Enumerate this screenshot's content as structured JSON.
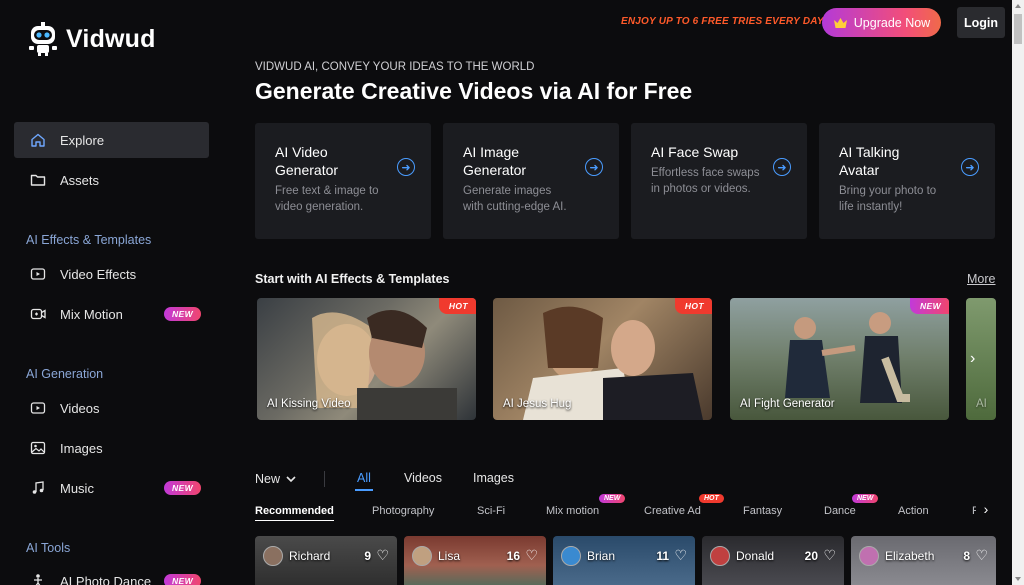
{
  "brand": {
    "name": "Vidwud"
  },
  "sidebar": {
    "top_items": [
      {
        "label": "Explore",
        "icon": "home-icon",
        "active": true
      },
      {
        "label": "Assets",
        "icon": "folder-icon"
      }
    ],
    "sections": [
      {
        "title": "AI Effects & Templates",
        "items": [
          {
            "label": "Video Effects",
            "icon": "video-effects-icon"
          },
          {
            "label": "Mix Motion",
            "icon": "mix-motion-icon",
            "badge": "NEW"
          }
        ]
      },
      {
        "title": "AI Generation",
        "items": [
          {
            "label": "Videos",
            "icon": "video-icon"
          },
          {
            "label": "Images",
            "icon": "image-icon"
          },
          {
            "label": "Music",
            "icon": "music-icon",
            "badge": "NEW"
          }
        ]
      },
      {
        "title": "AI Tools",
        "items": [
          {
            "label": "AI Photo Dance",
            "icon": "dance-icon",
            "badge": "NEW"
          }
        ]
      }
    ]
  },
  "topbar": {
    "promo": "ENJOY UP TO 6 FREE TRIES EVERY DAY!",
    "upgrade_label": "Upgrade Now",
    "login_label": "Login"
  },
  "hero": {
    "tagline": "VIDWUD AI, CONVEY YOUR IDEAS TO THE WORLD",
    "headline": "Generate Creative Videos via AI for Free"
  },
  "tools": [
    {
      "title": "AI Video Generator",
      "desc": "Free text & image to video generation."
    },
    {
      "title": "AI Image Generator",
      "desc": "Generate images with cutting-edge AI."
    },
    {
      "title": "AI Face Swap",
      "desc": "Effortless face swaps in photos or videos."
    },
    {
      "title": "AI Talking Avatar",
      "desc": "Bring your photo to life instantly!"
    }
  ],
  "templates_section": {
    "title": "Start with AI Effects & Templates",
    "more_label": "More",
    "items": [
      {
        "label": "AI Kissing Video",
        "badge": "HOT"
      },
      {
        "label": "AI Jesus Hug",
        "badge": "HOT"
      },
      {
        "label": "AI Fight Generator",
        "badge": "NEW"
      },
      {
        "label": "AI"
      }
    ]
  },
  "filters": {
    "sort_label": "New",
    "type_tabs": [
      "All",
      "Videos",
      "Images"
    ],
    "active_type": "All",
    "categories": [
      {
        "label": "Recommended",
        "active": true
      },
      {
        "label": "Photography"
      },
      {
        "label": "Sci-Fi"
      },
      {
        "label": "Mix motion",
        "badge": "NEW"
      },
      {
        "label": "Creative Ad",
        "badge": "HOT"
      },
      {
        "label": "Fantasy"
      },
      {
        "label": "Dance",
        "badge": "NEW"
      },
      {
        "label": "Action"
      },
      {
        "label": "Fo"
      }
    ]
  },
  "feed": [
    {
      "name": "Richard",
      "likes": "9"
    },
    {
      "name": "Lisa",
      "likes": "16"
    },
    {
      "name": "Brian",
      "likes": "11"
    },
    {
      "name": "Donald",
      "likes": "20"
    },
    {
      "name": "Elizabeth",
      "likes": "8"
    }
  ],
  "colors": {
    "accent": "#4a9cff",
    "hot": "#f03a2e",
    "promo": "#ff5a2a",
    "new_gradient_start": "#c23ad9",
    "new_gradient_end": "#f0456e"
  }
}
